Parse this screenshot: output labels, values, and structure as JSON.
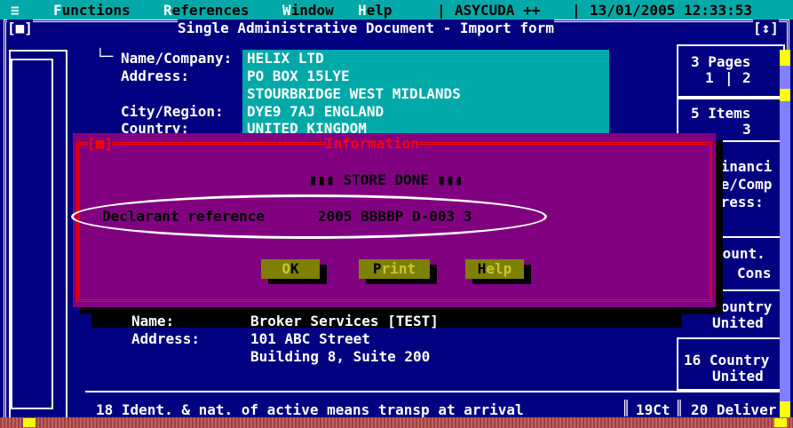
{
  "menubar": {
    "system_menu": "≡",
    "items": [
      {
        "hot": "F",
        "rest": "unctions"
      },
      {
        "hot": "R",
        "rest": "eferences"
      },
      {
        "hot": "W",
        "rest": "indow"
      },
      {
        "hot": "H",
        "rest": "elp"
      }
    ],
    "app_name": "ASYCUDA ++",
    "datetime": "13/01/2005 12:33:53"
  },
  "window": {
    "title": "Single Administrative Document - Import form",
    "close_box": "[■]",
    "zoom_box": "[↕]"
  },
  "importer": {
    "name_label": "Name/Company:",
    "name_value": "HELIX LTD",
    "address_label": "Address:",
    "address_line1": "PO BOX 15LYE",
    "address_line2": "STOURBRIDGE WEST MIDLANDS",
    "city_label": "City/Region:",
    "city_value": "DYE9 7AJ ENGLAND",
    "country_label": "Country:",
    "country_value": "UNITED KINGDOM"
  },
  "right_column": {
    "pages_label": "3 Pages",
    "pages_value_a": "1",
    "pages_value_b": "2",
    "items_label": "5 Items",
    "items_value": "3",
    "financial_1": "Financi",
    "financial_2": "me/Comp",
    "financial_3": "dress:",
    "count_label": "Count.",
    "cons_label": "Cons",
    "country_label_1": "Country",
    "country_value_1": "United",
    "country_label_2": "16 Country",
    "country_value_2": "United",
    "delivery_label": "20 Deliver"
  },
  "declarant": {
    "name_label": "Name:",
    "name_value": "Broker Services [TEST]",
    "address_label": "Address:",
    "address_line1": "101 ABC Street",
    "address_line2": "Building 8, Suite 200"
  },
  "bottom": {
    "transport_label": "18 Ident. & nat. of active means transp at arrival",
    "ct_label": "19Ct"
  },
  "dialog": {
    "close_box": "[■]",
    "title": "Information",
    "message": "▮▮▮ STORE DONE ▮▮▮",
    "decl_ref_label": "Declarant reference",
    "decl_ref_value": "2005 BBBBP D-003 3",
    "buttons": [
      {
        "hot": "O",
        "rest": "K"
      },
      {
        "hot": "P",
        "rest": "rint"
      },
      {
        "hot": "H",
        "rest": "elp"
      }
    ]
  }
}
